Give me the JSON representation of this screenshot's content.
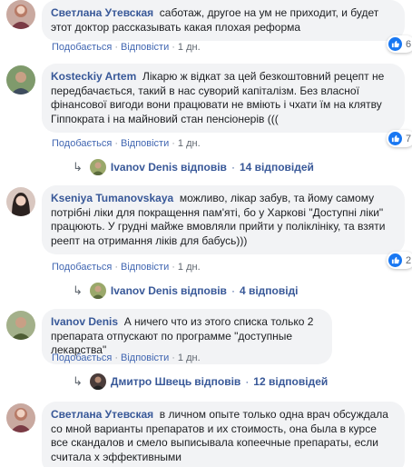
{
  "comments": [
    {
      "author": "Светлана Утевская",
      "text": "саботаж, другое на ум не приходит, и будет этот доктор рассказывать какая плохая реформа",
      "like_label": "Подобається",
      "reply_label": "Відповісти",
      "time": "1 дн.",
      "likes": "6"
    },
    {
      "author": "Kosteckiy Artem",
      "text": "Лікарю ж відкат за цей безкоштовний рецепт не передбачається, такий в нас суворий капіталізм. Без власної фінансової вигоди вони працювати не вміють і чхати їм на клятву Гіппократа і на майновий стан пенсіонерів (((",
      "like_label": "Подобається",
      "reply_label": "Відповісти",
      "time": "1 дн.",
      "likes": "7",
      "replies": {
        "name": "Ivanov Denis",
        "verb": "відповів",
        "count": "14 відповідей"
      }
    },
    {
      "author": "Kseniya Tumanovskaya",
      "text": "можливо, лікар забув, та йому самому потрібні ліки для покращення пам'яті, бо у Харкові \"Доступні ліки\" працюють. У грудні майже вмовляли прийти у поліклініку, та взяти реепт на отримання ліків для бабусь)))",
      "like_label": "Подобається",
      "reply_label": "Відповісти",
      "time": "1 дн.",
      "likes": "2",
      "replies": {
        "name": "Ivanov Denis",
        "verb": "відповів",
        "count": "4 відповіді"
      }
    },
    {
      "author": "Ivanov Denis",
      "text": "А ничего что из этого списка только 2 препарата отпускают по программе \"доступные лекарства\"",
      "like_label": "Подобається",
      "reply_label": "Відповісти",
      "time": "1 дн.",
      "replies": {
        "name": "Дмитро Швець",
        "verb": "відповів",
        "count": "12 відповідей"
      }
    },
    {
      "author": "Светлана Утевская",
      "text": "в личном опыте только одна врач обсуждала со мной варианты препаратов и их стоимость, она была в курсе все скандалов и смело выписывала копеечные препараты, если считала х эффективными"
    }
  ],
  "colors": {
    "link": "#385898",
    "bubble": "#f2f3f5",
    "like": "#1877f2"
  }
}
